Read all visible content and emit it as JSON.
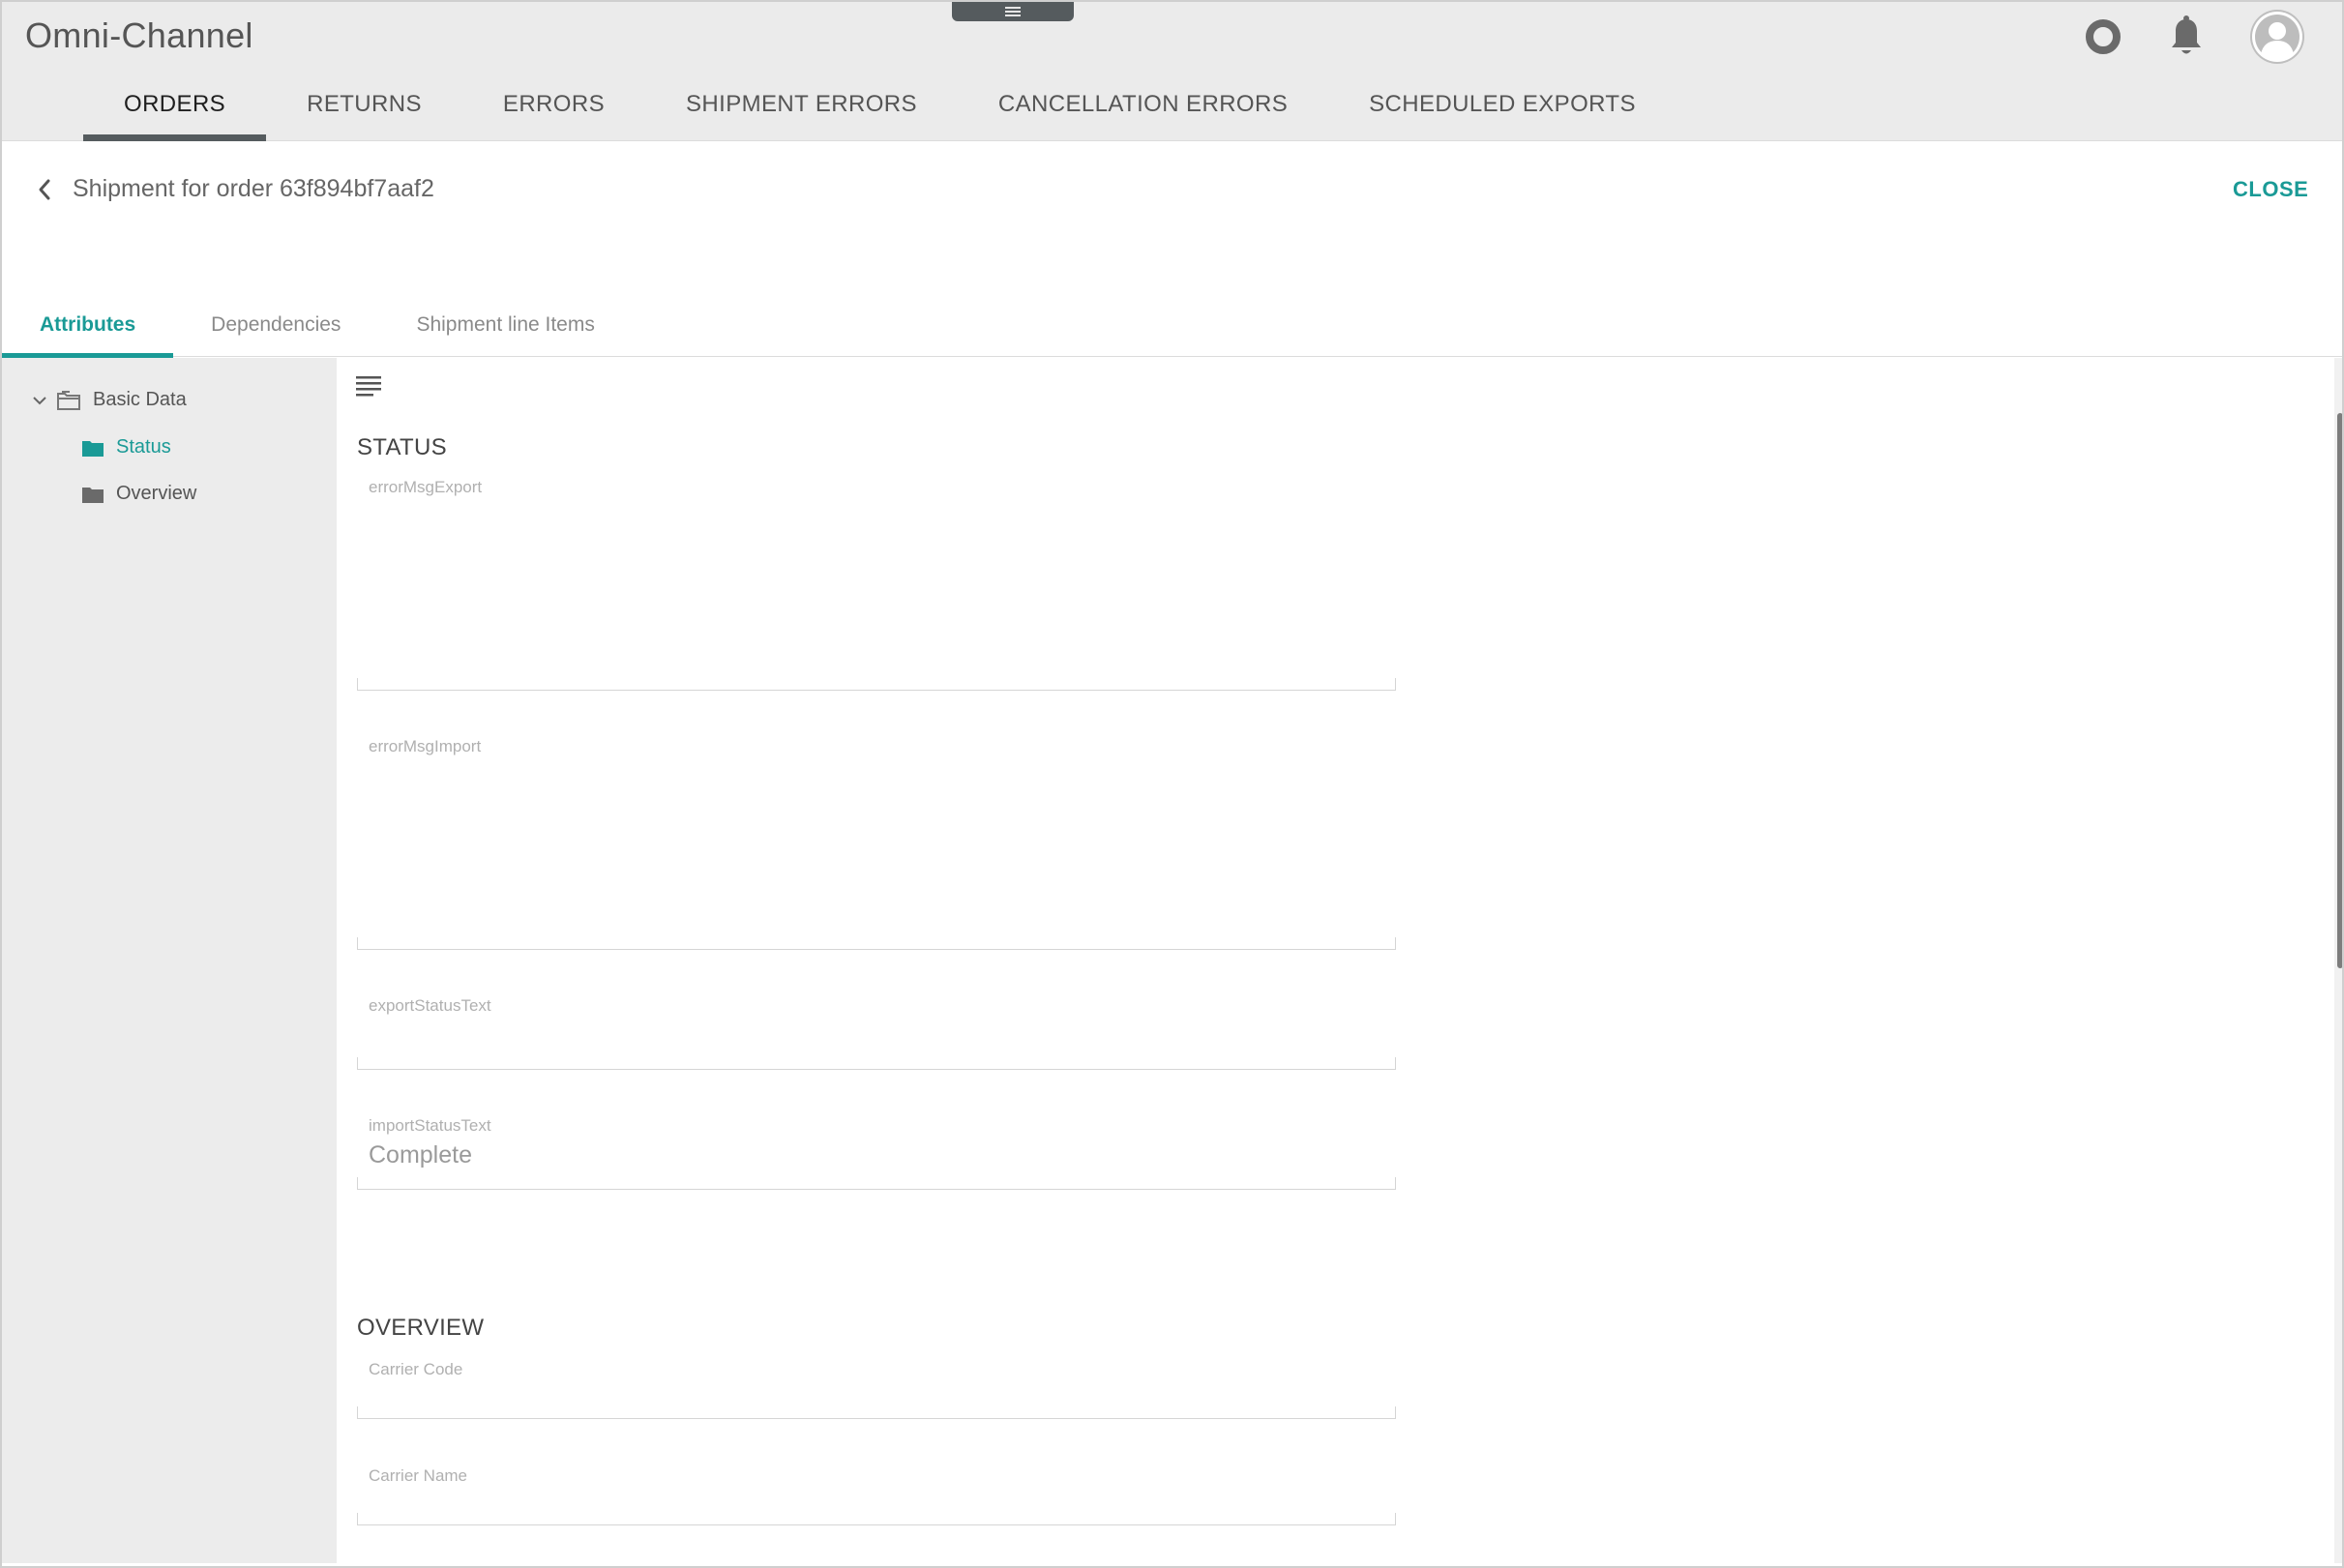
{
  "header": {
    "app_title": "Omni-Channel",
    "icons": [
      "drawer-handle-icon",
      "ring-icon",
      "bell-icon",
      "avatar-icon"
    ]
  },
  "nav": {
    "tabs": [
      {
        "label": "ORDERS",
        "active": true
      },
      {
        "label": "RETURNS",
        "active": false
      },
      {
        "label": "ERRORS",
        "active": false
      },
      {
        "label": "SHIPMENT ERRORS",
        "active": false
      },
      {
        "label": "CANCELLATION ERRORS",
        "active": false
      },
      {
        "label": "SCHEDULED EXPORTS",
        "active": false
      }
    ]
  },
  "subheader": {
    "title": "Shipment for order 63f894bf7aaf2",
    "close_label": "CLOSE"
  },
  "detail_tabs": [
    {
      "label": "Attributes",
      "active": true
    },
    {
      "label": "Dependencies",
      "active": false
    },
    {
      "label": "Shipment line Items",
      "active": false
    }
  ],
  "tree": {
    "root": "Basic Data",
    "children": [
      {
        "label": "Status",
        "selected": true
      },
      {
        "label": "Overview",
        "selected": false
      }
    ]
  },
  "sections": {
    "status": {
      "title": "STATUS",
      "fields": [
        {
          "label": "errorMsgExport",
          "value": ""
        },
        {
          "label": "errorMsgImport",
          "value": ""
        },
        {
          "label": "exportStatusText",
          "value": ""
        },
        {
          "label": "importStatusText",
          "value": "Complete"
        }
      ]
    },
    "overview": {
      "title": "OVERVIEW",
      "fields": [
        {
          "label": "Carrier Code",
          "value": ""
        },
        {
          "label": "Carrier Name",
          "value": ""
        }
      ]
    }
  },
  "colors": {
    "accent": "#1a9a96",
    "header_bg": "#ebebeb",
    "sidebar_bg": "#ececec",
    "tab_indicator": "#555b5e"
  }
}
